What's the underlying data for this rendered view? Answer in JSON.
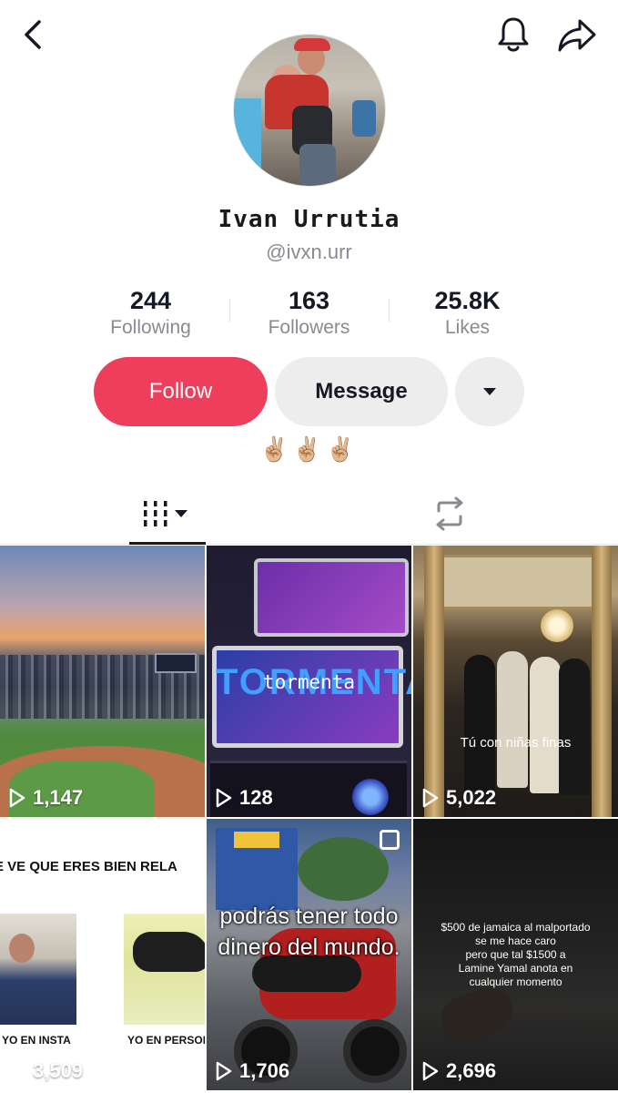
{
  "profile": {
    "display_name": "Ivan Urrutia",
    "handle": "@ivxn.urr",
    "bio": "✌🏼✌🏼✌🏼"
  },
  "stats": {
    "following": {
      "value": "244",
      "label": "Following"
    },
    "followers": {
      "value": "163",
      "label": "Followers"
    },
    "likes": {
      "value": "25.8K",
      "label": "Likes"
    }
  },
  "actions": {
    "follow_label": "Follow",
    "message_label": "Message"
  },
  "icons": {
    "back": "chevron-left-icon",
    "notifications": "bell-icon",
    "share": "share-arrow-icon",
    "more": "caret-down-icon",
    "videos_tab": "grid-bars-icon",
    "reposts_tab": "repost-icon",
    "play": "play-icon"
  },
  "colors": {
    "follow_button": "#ee3e5c",
    "secondary_button": "#ededee",
    "muted_text": "#8a8b91"
  },
  "videos": [
    {
      "views": "1,147",
      "caption": ""
    },
    {
      "views": "128",
      "caption": "tormenta",
      "overlay_text": "TORMENTA"
    },
    {
      "views": "5,022",
      "caption": "Tú con niñas finas"
    },
    {
      "views": "3,509",
      "caption": "E VE QUE ERES BIEN RELA",
      "label_left": "YO EN INSTA",
      "label_right": "YO EN PERSON"
    },
    {
      "views": "1,706",
      "caption_line1": "podrás tener todo",
      "caption_line2": "dinero del mundo."
    },
    {
      "views": "2,696",
      "caption_line1": "$500 de jamaica al malportado",
      "caption_line2": "se me hace caro",
      "caption_line3": "pero que tal $1500 a",
      "caption_line4": "Lamine Yamal anota en",
      "caption_line5": "cualquier momento"
    }
  ]
}
